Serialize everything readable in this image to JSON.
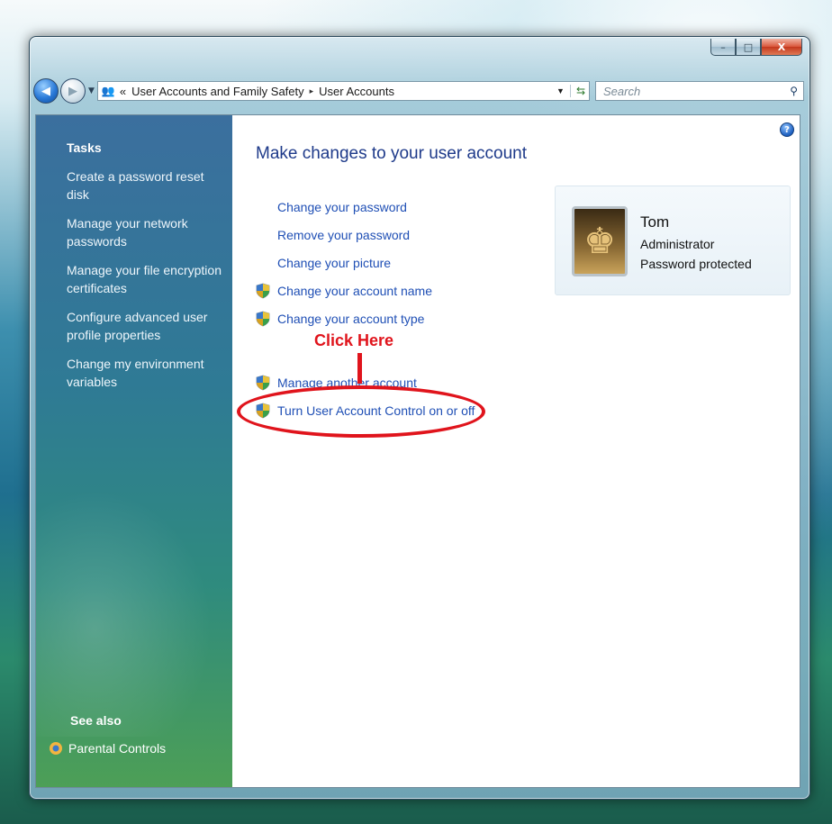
{
  "window": {
    "caption_buttons": {
      "minimize": "–",
      "maximize": "□",
      "close": "X"
    }
  },
  "navigation": {
    "breadcrumb_prefix": "«",
    "breadcrumb": [
      "User Accounts and Family Safety",
      "User Accounts"
    ],
    "breadcrumb_separator": "▸",
    "search_placeholder": "Search"
  },
  "sidebar": {
    "tasks_title": "Tasks",
    "tasks": [
      "Create a password reset disk",
      "Manage your network passwords",
      "Manage your file encryption certificates",
      "Configure advanced user profile properties",
      "Change my environment variables"
    ],
    "see_also_title": "See also",
    "see_also": [
      "Parental Controls"
    ]
  },
  "main": {
    "heading": "Make changes to your user account",
    "links": [
      {
        "label": "Change your password",
        "shield": false
      },
      {
        "label": "Remove your password",
        "shield": false
      },
      {
        "label": "Change your picture",
        "shield": false
      },
      {
        "label": "Change your account name",
        "shield": true
      },
      {
        "label": "Change your account type",
        "shield": true
      },
      {
        "label": "Manage another account",
        "shield": true
      },
      {
        "label": "Turn User Account Control on or off",
        "shield": true
      }
    ]
  },
  "user": {
    "name": "Tom",
    "role": "Administrator",
    "status": "Password protected"
  },
  "annotation": {
    "text": "Click Here",
    "color": "#e0141c"
  },
  "colors": {
    "link": "#1f4fb5",
    "heading": "#1e3a8a"
  }
}
